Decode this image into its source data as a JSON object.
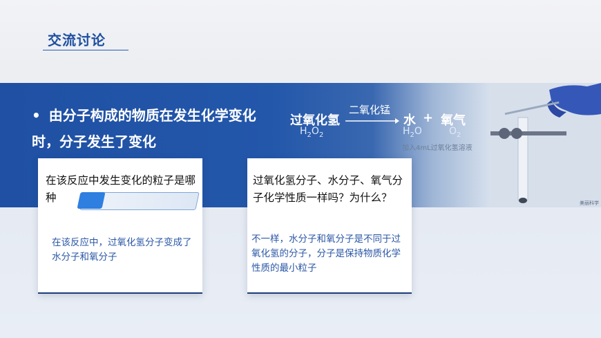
{
  "slide": {
    "title": "交流讨论",
    "bullet": "由分子构成的物质在发生化学变化时，分子发生了变化",
    "equation": {
      "reactant": "过氧化氢",
      "reactant_formula": {
        "main": "H",
        "sub1": "2",
        "mid": "O",
        "sub2": "2"
      },
      "catalyst": "二氧化锰",
      "product1": "水",
      "plus": "+",
      "product2": "氧气",
      "product1_formula": {
        "main": "H",
        "sub1": "2",
        "mid": "O"
      },
      "product2_formula": {
        "main": "O",
        "sub1": "2"
      },
      "note": "加入4mL过氧化氢溶液"
    },
    "logo_text": "美丽科学",
    "cards": [
      {
        "question": "在该反应中发生变化的粒子是哪种",
        "answer": "在该反应中，过氧化氢分子变成了水分子和氧分子"
      },
      {
        "question": "过氧化氢分子、水分子、氧气分子化学性质一样吗？为什么？",
        "answer": "不一样，水分子和氧分子是不同于过氧化氢的分子，分子是保持物质化学性质的最小粒子"
      }
    ],
    "colors": {
      "accent": "#1f50a3",
      "answer_text": "#2b57a6"
    }
  }
}
